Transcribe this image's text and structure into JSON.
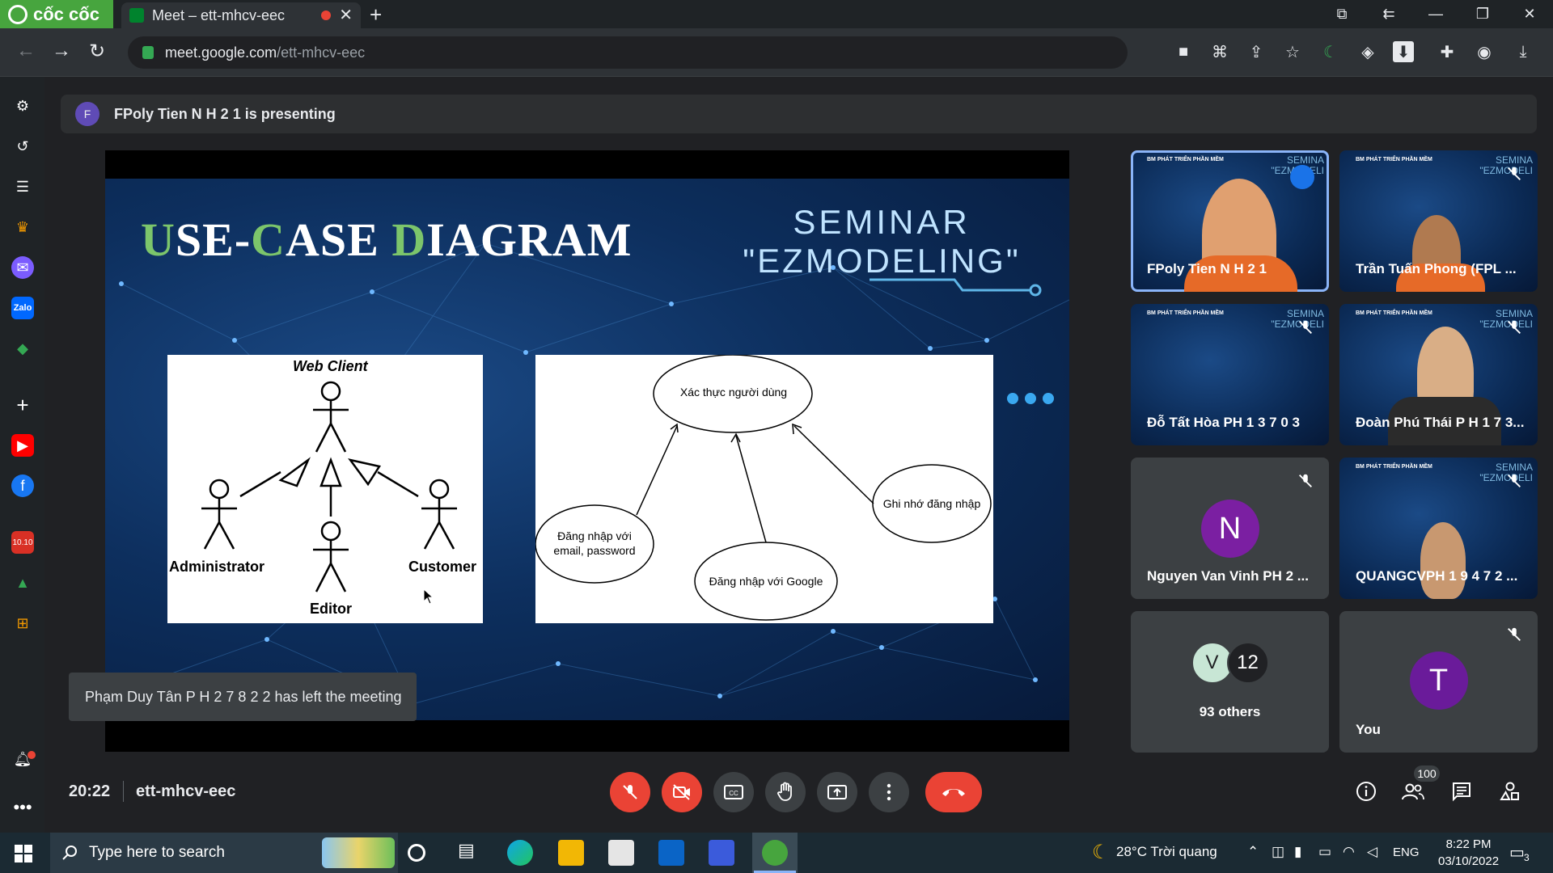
{
  "browser": {
    "brand": "cốc cốc",
    "tab_title": "Meet – ett-mhcv-eec",
    "url_domain": "meet.google.com",
    "url_path": "/ett-mhcv-eec"
  },
  "meet": {
    "presenting": "FPoly Tien N H 2 1 is presenting",
    "presenter_initial": "F",
    "toast": "Phạm Duy Tân P H 2 7 8 2 2 has left the meeting",
    "time": "20:22",
    "code": "ett-mhcv-eec",
    "participant_count": "100"
  },
  "slide": {
    "title_first_a": "U",
    "title_first_b": "SE-",
    "title_c": "C",
    "title_c_rest": "ASE ",
    "title_d": "D",
    "title_d_rest": "IAGRAM",
    "seminar_line1": "SEMINAR",
    "seminar_line2": "\"EZMODELING\"",
    "diagram1": {
      "system": "Web Client",
      "actors": [
        "Administrator",
        "Editor",
        "Customer"
      ]
    },
    "diagram2": {
      "cases": [
        "Xác thực người dùng",
        "Đăng nhập với email, password",
        "Đăng nhập với Google",
        "Ghi nhớ đăng nhập"
      ]
    }
  },
  "tiles": [
    {
      "name": "FPoly Tien N H 2 1"
    },
    {
      "name": "Trần Tuấn Phong (FPL ..."
    },
    {
      "name": "Đỗ Tất Hòa PH 1 3 7 0 3"
    },
    {
      "name": "Đoàn Phú Thái P H 1 7 3..."
    },
    {
      "name": "Nguyen Van Vinh PH 2 ...",
      "initial": "N"
    },
    {
      "name": "QUANGCVPH 1 9 4 7 2 ..."
    },
    {
      "name": "93 others",
      "avatar1": "V",
      "avatar2": "12"
    },
    {
      "name": "You",
      "initial": "T"
    }
  ],
  "tile_brand": {
    "logo": "BM PHÁT TRIỂN PHẦN MỀM",
    "seminar": "SEMINA",
    "ez": "\"EZMODELI"
  },
  "taskbar": {
    "search_placeholder": "Type here to search",
    "weather": "28°C  Trời quang",
    "lang": "ENG",
    "time": "8:22 PM",
    "date": "03/10/2022",
    "notif": "3"
  },
  "colors": {
    "accent_red": "#ea4335",
    "meet_bg": "#202124",
    "brand_green": "#47a53e"
  }
}
